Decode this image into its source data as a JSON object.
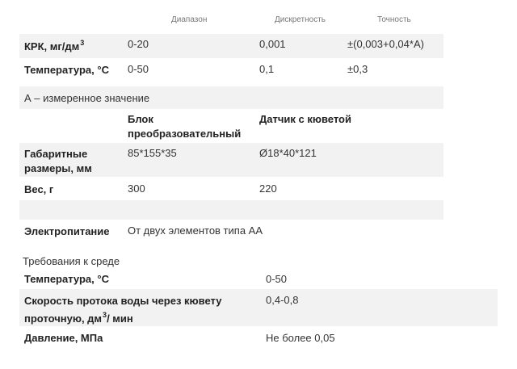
{
  "table1": {
    "headers": {
      "range": "Диапазон",
      "discreteness": "Дискретность",
      "accuracy": "Точность"
    },
    "rows": [
      {
        "label": "КРК, мг/дм",
        "label_sup": "3",
        "range": "0-20",
        "discreteness": "0,001",
        "accuracy": "±(0,003+0,04*A)"
      },
      {
        "label": "Температура, °С",
        "range": "0-50",
        "discreteness": "0,1",
        "accuracy": "±0,3"
      }
    ]
  },
  "note": "А – измеренное значение",
  "table2": {
    "headers": {
      "block": "Блок преобразовательный",
      "sensor": "Датчик с кюветой"
    },
    "rows": [
      {
        "label": "Габаритные размеры, мм",
        "block": "85*155*35",
        "sensor": "Ø18*40*121"
      },
      {
        "label": "Вес, г",
        "block": "300",
        "sensor": "220"
      },
      {
        "label": "Электропитание",
        "block": "От двух элементов типа АА"
      }
    ]
  },
  "env": {
    "title": "Требования к среде",
    "rows": [
      {
        "label": "Температура, °С",
        "value": "0-50"
      },
      {
        "label": "Скорость протока воды через кювету проточную, дм",
        "label_sup": "3",
        "label_suffix": "/ мин",
        "value": "0,4-0,8"
      },
      {
        "label": "Давление, МПа",
        "value": "Не более 0,05"
      }
    ]
  }
}
